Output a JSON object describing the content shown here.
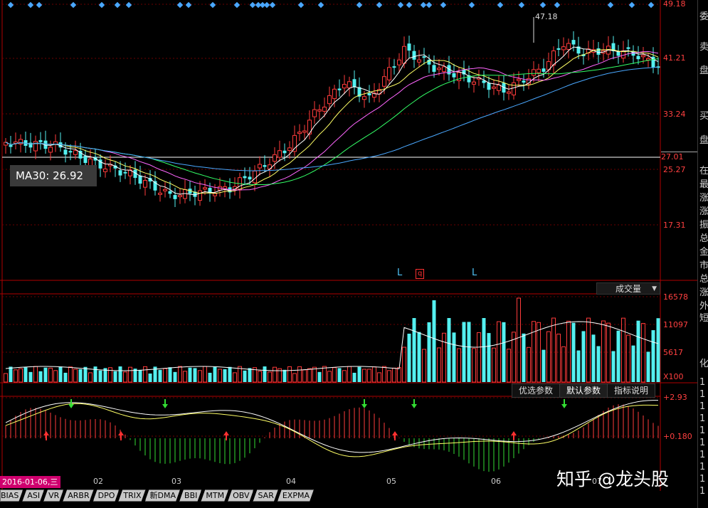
{
  "price_axis": {
    "labels": [
      "49.18",
      "41.21",
      "33.24",
      "25.27",
      "17.31"
    ],
    "current": "27.01",
    "peak": "47.18"
  },
  "tooltip": "MA30: 26.92",
  "markers": [
    "L",
    "q",
    "L"
  ],
  "volume": {
    "dropdown_label": "成交量",
    "labels": [
      "16578",
      "11097",
      "5617",
      "X100"
    ]
  },
  "params": {
    "tabs": [
      "优选参数",
      "默认参数",
      "指标说明"
    ]
  },
  "macd": {
    "labels": [
      "+2.93",
      "+0.180"
    ]
  },
  "date_tag": "2016-01-06,三",
  "months": [
    "02",
    "03",
    "04",
    "05",
    "06",
    "07"
  ],
  "indicator_tabs": [
    "BIAS",
    "ASI",
    "VR",
    "ARBR",
    "DPO",
    "TRIX",
    "新DMA",
    "BBI",
    "MTM",
    "OBV",
    "SAR",
    "EXPMA"
  ],
  "side_panel": [
    "委",
    "卖",
    "盘",
    "买",
    "盘",
    "在",
    "最",
    "涨",
    "涨",
    "振",
    "总",
    "金",
    "市",
    "总",
    "涨",
    "外",
    "短",
    "化",
    "1",
    "1",
    "1",
    "1",
    "1",
    "1",
    "1",
    "1",
    "1",
    "1"
  ],
  "watermark": "知乎 @龙头股",
  "colors": {
    "up": "#ff3b3b",
    "down": "#54f0f0",
    "ma5": "#ffffff",
    "ma10": "#ffff66",
    "ma20": "#ff66ff",
    "ma30": "#33ff66",
    "ma60": "#4aa8ff"
  }
}
